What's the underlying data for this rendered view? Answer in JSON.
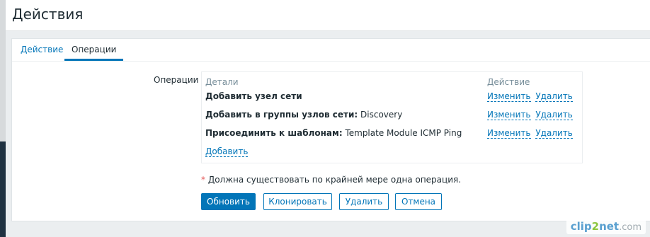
{
  "header": {
    "title": "Действия"
  },
  "tabs": [
    {
      "label": "Действие",
      "active": false
    },
    {
      "label": "Операции",
      "active": true
    }
  ],
  "operations": {
    "label": "Операции",
    "columns": {
      "details": "Детали",
      "action": "Действие"
    },
    "rows": [
      {
        "bold": "Добавить узел сети",
        "rest": "",
        "edit": "Изменить",
        "remove": "Удалить"
      },
      {
        "bold": "Добавить в группы узлов сети:",
        "rest": " Discovery",
        "edit": "Изменить",
        "remove": "Удалить"
      },
      {
        "bold": "Присоединить к шаблонам:",
        "rest": " Template Module ICMP Ping",
        "edit": "Изменить",
        "remove": "Удалить"
      }
    ],
    "add_label": "Добавить"
  },
  "notice": {
    "star": "*",
    "text": " Должна существовать по крайней мере одна операция."
  },
  "buttons": {
    "update": "Обновить",
    "clone": "Клонировать",
    "delete": "Удалить",
    "cancel": "Отмена"
  },
  "watermark": {
    "p1": "clip",
    "p2": "2",
    "p3": "net",
    "p4": ".com"
  },
  "colors": {
    "accent": "#0275b8",
    "required": "#e45959",
    "background": "#ebeef0"
  }
}
